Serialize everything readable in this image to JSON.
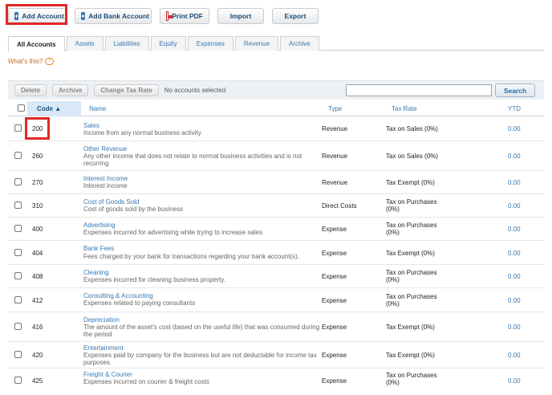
{
  "toolbar": {
    "add_account": "Add Account",
    "add_bank_account": "Add Bank Account",
    "print_pdf": "Print PDF",
    "import": "Import",
    "export": "Export"
  },
  "tabs": [
    "All Accounts",
    "Assets",
    "Liabilities",
    "Equity",
    "Expenses",
    "Revenue",
    "Archive"
  ],
  "whats_this": "What's this?",
  "whats_this_icon": "?",
  "actions": {
    "delete": "Delete",
    "archive": "Archive",
    "change_tax_rate": "Change Tax Rate",
    "selection_note": "No accounts selected",
    "search": "Search"
  },
  "table": {
    "headers": {
      "code": "Code ▲",
      "name": "Name",
      "type": "Type",
      "tax_rate": "Tax Rate",
      "ytd": "YTD"
    },
    "rows": [
      {
        "code": "200",
        "name": "Sales",
        "desc": "Income from any normal business activity",
        "type": "Revenue",
        "tax": "Tax on Sales (0%)",
        "ytd": "0.00"
      },
      {
        "code": "260",
        "name": "Other Revenue",
        "desc": "Any other income that does not relate to normal business activities and is not recurring",
        "type": "Revenue",
        "tax": "Tax on Sales (0%)",
        "ytd": "0.00"
      },
      {
        "code": "270",
        "name": "Interest Income",
        "desc": "Interest income",
        "type": "Revenue",
        "tax": "Tax Exempt (0%)",
        "ytd": "0.00"
      },
      {
        "code": "310",
        "name": "Cost of Goods Sold",
        "desc": "Cost of goods sold by the business",
        "type": "Direct Costs",
        "tax": "Tax on Purchases (0%)",
        "ytd": "0.00"
      },
      {
        "code": "400",
        "name": "Advertising",
        "desc": "Expenses incurred for advertising while trying to increase sales",
        "type": "Expense",
        "tax": "Tax on Purchases (0%)",
        "ytd": "0.00"
      },
      {
        "code": "404",
        "name": "Bank Fees",
        "desc": "Fees charged by your bank for transactions regarding your bank account(s).",
        "type": "Expense",
        "tax": "Tax Exempt (0%)",
        "ytd": "0.00"
      },
      {
        "code": "408",
        "name": "Cleaning",
        "desc": "Expenses incurred for cleaning business property.",
        "type": "Expense",
        "tax": "Tax on Purchases (0%)",
        "ytd": "0.00"
      },
      {
        "code": "412",
        "name": "Consulting & Accounting",
        "desc": "Expenses related to paying consultants",
        "type": "Expense",
        "tax": "Tax on Purchases (0%)",
        "ytd": "0.00"
      },
      {
        "code": "416",
        "name": "Depreciation",
        "desc": "The amount of the asset's cost (based on the useful life) that was consumed during the period",
        "type": "Expense",
        "tax": "Tax Exempt (0%)",
        "ytd": "0.00"
      },
      {
        "code": "420",
        "name": "Entertainment",
        "desc": "Expenses paid by company for the business but are not deductable for income tax purposes.",
        "type": "Expense",
        "tax": "Tax Exempt (0%)",
        "ytd": "0.00"
      },
      {
        "code": "425",
        "name": "Freight & Courier",
        "desc": "Expenses incurred on courier & freight costs",
        "type": "Expense",
        "tax": "Tax on Purchases (0%)",
        "ytd": "0.00"
      }
    ]
  },
  "colors": {
    "link": "#3a78b0",
    "highlight": "#e02727",
    "panel": "#eef1f4"
  }
}
